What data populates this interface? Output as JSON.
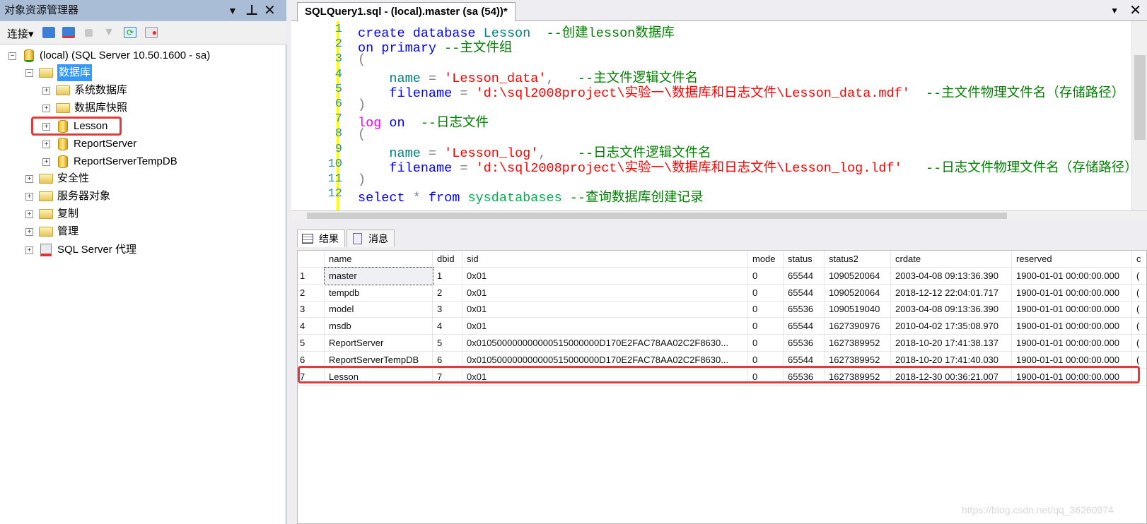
{
  "object_explorer": {
    "title": "对象资源管理器",
    "connect_label": "连接",
    "tree": [
      {
        "label": "(local) (SQL Server 10.50.1600 - sa)",
        "level": 0,
        "icon": "server-icon",
        "expander": "−"
      },
      {
        "label": "数据库",
        "level": 1,
        "icon": "folder-icon",
        "expander": "−",
        "selected": true
      },
      {
        "label": "系统数据库",
        "level": 2,
        "icon": "folder-icon",
        "expander": "+"
      },
      {
        "label": "数据库快照",
        "level": 2,
        "icon": "folder-icon",
        "expander": "+"
      },
      {
        "label": "Lesson",
        "level": 2,
        "icon": "database-icon",
        "expander": "+",
        "highlighted": true
      },
      {
        "label": "ReportServer",
        "level": 2,
        "icon": "database-icon",
        "expander": "+"
      },
      {
        "label": "ReportServerTempDB",
        "level": 2,
        "icon": "database-icon",
        "expander": "+"
      },
      {
        "label": "安全性",
        "level": 1,
        "icon": "folder-icon",
        "expander": "+"
      },
      {
        "label": "服务器对象",
        "level": 1,
        "icon": "folder-icon",
        "expander": "+"
      },
      {
        "label": "复制",
        "level": 1,
        "icon": "folder-icon",
        "expander": "+"
      },
      {
        "label": "管理",
        "level": 1,
        "icon": "folder-icon",
        "expander": "+"
      },
      {
        "label": "SQL Server 代理",
        "level": 1,
        "icon": "agent-icon",
        "expander": "+"
      }
    ]
  },
  "editor": {
    "tab_title": "SQLQuery1.sql - (local).master (sa (54))*",
    "colors": {
      "keyword": "#0000ff",
      "string": "#ff0000",
      "comment": "#008000",
      "system": "#00b050",
      "logkw": "#ff00ff",
      "plain": "#808080",
      "ident": "#008080"
    },
    "lines": [
      [
        [
          "create database ",
          "keyword"
        ],
        [
          "Lesson",
          "ident"
        ],
        [
          "  --创建lesson数据库",
          "comment"
        ]
      ],
      [
        [
          "on primary ",
          "keyword"
        ],
        [
          "--主文件组",
          "comment"
        ]
      ],
      [
        [
          "(",
          "plain"
        ]
      ],
      [
        [
          "    ",
          ""
        ],
        [
          "name",
          "ident"
        ],
        [
          " = ",
          "plain"
        ],
        [
          "'Lesson_data'",
          "string"
        ],
        [
          ",   ",
          "plain"
        ],
        [
          "--主文件逻辑文件名",
          "comment"
        ]
      ],
      [
        [
          "    ",
          ""
        ],
        [
          "filename",
          "keyword"
        ],
        [
          " = ",
          "plain"
        ],
        [
          "'d:\\sql2008project\\实验一\\数据库和日志文件\\Lesson_data.mdf'",
          "string"
        ],
        [
          "  --主文件物理文件名（存储路径）",
          "comment"
        ]
      ],
      [
        [
          ")",
          "plain"
        ]
      ],
      [
        [
          "log",
          "logkw"
        ],
        [
          " on",
          "keyword"
        ],
        [
          "  --日志文件",
          "comment"
        ]
      ],
      [
        [
          "(",
          "plain"
        ]
      ],
      [
        [
          "    ",
          ""
        ],
        [
          "name",
          "ident"
        ],
        [
          " = ",
          "plain"
        ],
        [
          "'Lesson_log'",
          "string"
        ],
        [
          ",    ",
          "plain"
        ],
        [
          "--日志文件逻辑文件名",
          "comment"
        ]
      ],
      [
        [
          "    ",
          ""
        ],
        [
          "filename",
          "keyword"
        ],
        [
          " = ",
          "plain"
        ],
        [
          "'d:\\sql2008project\\实验一\\数据库和日志文件\\Lesson_log.ldf'",
          "string"
        ],
        [
          "   --日志文件物理文件名（存储路径）",
          "comment"
        ]
      ],
      [
        [
          ")",
          "plain"
        ]
      ],
      [
        [
          "select ",
          "keyword"
        ],
        [
          "* ",
          "plain"
        ],
        [
          "from ",
          "keyword"
        ],
        [
          "sysdatabases",
          "system"
        ],
        [
          " --查询数据库创建记录",
          "comment"
        ]
      ]
    ]
  },
  "results": {
    "tabs": [
      {
        "label": "结果",
        "icon": "grid-icon"
      },
      {
        "label": "消息",
        "icon": "message-icon"
      }
    ],
    "columns": [
      "",
      "name",
      "dbid",
      "sid",
      "mode",
      "status",
      "status2",
      "crdate",
      "reserved",
      "c"
    ],
    "rows": [
      [
        "1",
        "master",
        "1",
        "0x01",
        "0",
        "65544",
        "1090520064",
        "2003-04-08 09:13:36.390",
        "1900-01-01 00:00:00.000",
        "("
      ],
      [
        "2",
        "tempdb",
        "2",
        "0x01",
        "0",
        "65544",
        "1090520064",
        "2018-12-12 22:04:01.717",
        "1900-01-01 00:00:00.000",
        "("
      ],
      [
        "3",
        "model",
        "3",
        "0x01",
        "0",
        "65536",
        "1090519040",
        "2003-04-08 09:13:36.390",
        "1900-01-01 00:00:00.000",
        "("
      ],
      [
        "4",
        "msdb",
        "4",
        "0x01",
        "0",
        "65544",
        "1627390976",
        "2010-04-02 17:35:08.970",
        "1900-01-01 00:00:00.000",
        "("
      ],
      [
        "5",
        "ReportServer",
        "5",
        "0x010500000000000515000000D170E2FAC78AA02C2F8630...",
        "0",
        "65536",
        "1627389952",
        "2018-10-20 17:41:38.137",
        "1900-01-01 00:00:00.000",
        "("
      ],
      [
        "6",
        "ReportServerTempDB",
        "6",
        "0x010500000000000515000000D170E2FAC78AA02C2F8630...",
        "0",
        "65544",
        "1627389952",
        "2018-10-20 17:41:40.030",
        "1900-01-01 00:00:00.000",
        "("
      ],
      [
        "7",
        "Lesson",
        "7",
        "0x01",
        "0",
        "65536",
        "1627389952",
        "2018-12-30 00:36:21.007",
        "1900-01-01 00:00:00.000",
        ""
      ]
    ]
  },
  "watermark": "https://blog.csdn.net/qq_36260974"
}
